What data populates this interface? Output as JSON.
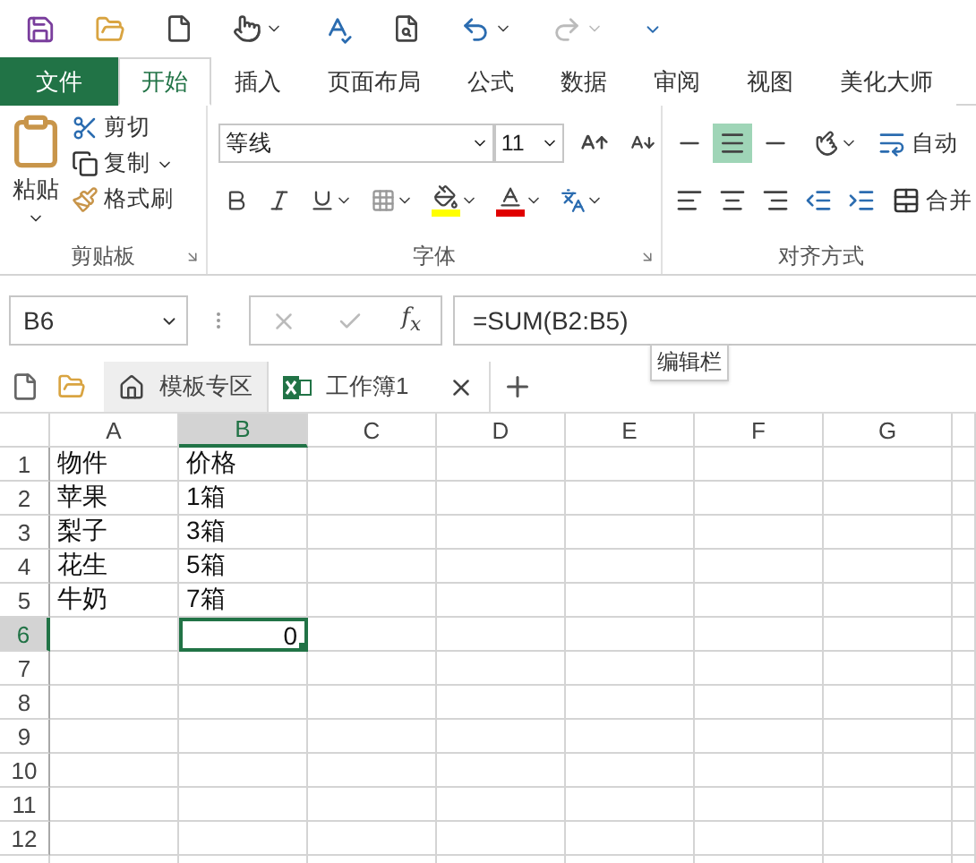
{
  "ribbon_tabs": [
    {
      "label": "文件",
      "kind": "file",
      "selected": false
    },
    {
      "label": "开始",
      "kind": "tab",
      "selected": true
    },
    {
      "label": "插入",
      "kind": "tab",
      "selected": false
    },
    {
      "label": "页面布局",
      "kind": "tab",
      "selected": false
    },
    {
      "label": "公式",
      "kind": "tab",
      "selected": false
    },
    {
      "label": "数据",
      "kind": "tab",
      "selected": false
    },
    {
      "label": "审阅",
      "kind": "tab",
      "selected": false
    },
    {
      "label": "视图",
      "kind": "tab",
      "selected": false
    },
    {
      "label": "美化大师",
      "kind": "tab",
      "selected": false
    }
  ],
  "clipboard": {
    "paste": "粘贴",
    "cut": "剪切",
    "copy": "复制",
    "format_painter": "格式刷",
    "group_label": "剪贴板"
  },
  "font": {
    "name": "等线",
    "size": "11",
    "group_label": "字体"
  },
  "alignment": {
    "vertical": [
      {
        "selected": false
      },
      {
        "selected": true
      },
      {
        "selected": false
      }
    ],
    "wrap": "自动",
    "merge": "合并",
    "group_label": "对齐方式"
  },
  "formula_bar": {
    "name_box": "B6",
    "function_label": "f$_{x}$",
    "formula": "=SUM(B2:B5)",
    "tooltip": "编辑栏"
  },
  "doc_tabs": [
    {
      "label": "模板专区",
      "kind": "template",
      "selected": false
    },
    {
      "label": "工作簿1",
      "kind": "workbook",
      "selected": true
    }
  ],
  "sheet": {
    "columns": [
      {
        "label": "A",
        "selected": false
      },
      {
        "label": "B",
        "selected": true
      },
      {
        "label": "C",
        "selected": false
      },
      {
        "label": "D",
        "selected": false
      },
      {
        "label": "E",
        "selected": false
      },
      {
        "label": "F",
        "selected": false
      },
      {
        "label": "G",
        "selected": false
      }
    ],
    "rows": [
      {
        "number": "1",
        "selected": false,
        "cells": [
          {
            "text": "物件",
            "kind": "text",
            "selected": false
          },
          {
            "text": "价格",
            "kind": "text",
            "selected": false
          }
        ]
      },
      {
        "number": "2",
        "selected": false,
        "cells": [
          {
            "text": "苹果",
            "kind": "text",
            "selected": false
          },
          {
            "text": "1箱",
            "kind": "text",
            "selected": false
          }
        ]
      },
      {
        "number": "3",
        "selected": false,
        "cells": [
          {
            "text": "梨子",
            "kind": "text",
            "selected": false
          },
          {
            "text": "3箱",
            "kind": "text",
            "selected": false
          }
        ]
      },
      {
        "number": "4",
        "selected": false,
        "cells": [
          {
            "text": "花生",
            "kind": "text",
            "selected": false
          },
          {
            "text": "5箱",
            "kind": "text",
            "selected": false
          }
        ]
      },
      {
        "number": "5",
        "selected": false,
        "cells": [
          {
            "text": "牛奶",
            "kind": "text",
            "selected": false
          },
          {
            "text": "7箱",
            "kind": "text",
            "selected": false
          }
        ]
      },
      {
        "number": "6",
        "selected": true,
        "cells": [
          {
            "kind": "empty",
            "selected": false
          },
          {
            "text": "0",
            "kind": "number",
            "selected": true
          }
        ]
      },
      {
        "number": "7",
        "selected": false
      },
      {
        "number": "8",
        "selected": false
      },
      {
        "number": "9",
        "selected": false
      },
      {
        "number": "10",
        "selected": false
      },
      {
        "number": "11",
        "selected": false
      },
      {
        "number": "12",
        "selected": false
      }
    ]
  }
}
